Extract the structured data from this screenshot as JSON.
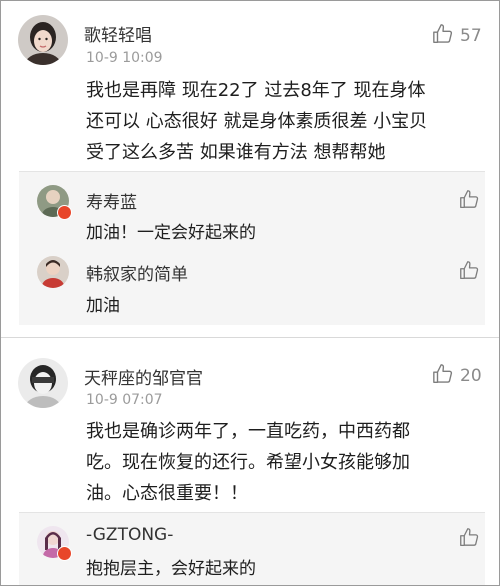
{
  "comments": [
    {
      "username": "歌轻轻唱",
      "time": "10-9 10:09",
      "likes": "57",
      "text_lines": [
        "我也是再障 现在22了 过去8年了  现在身体",
        "还可以 心态很好 就是身体素质很差  小宝贝",
        "受了这么多苦 如果谁有方法 想帮帮她"
      ],
      "replies": [
        {
          "username": "寿寿蓝",
          "text": "加油！一定会好起来的"
        },
        {
          "username": "韩叙家的简单",
          "text": "加油"
        }
      ]
    },
    {
      "username": "天秤座的邹官官",
      "time": "10-9 07:07",
      "likes": "20",
      "text_lines": [
        "我也是确诊两年了，一直吃药，中西药都",
        "吃。现在恢复的还行。希望小女孩能够加",
        "油。心态很重要！！"
      ],
      "replies": [
        {
          "username": "-GZTONG-",
          "text": "抱抱层主，会好起来的"
        }
      ]
    }
  ],
  "icons": {
    "like": "thumbs-up-icon",
    "badge": "verified-badge-icon"
  },
  "colors": {
    "reply_background": "#f5f5f5",
    "badge": "#e8462a",
    "timestamp": "#9b9b9b"
  }
}
